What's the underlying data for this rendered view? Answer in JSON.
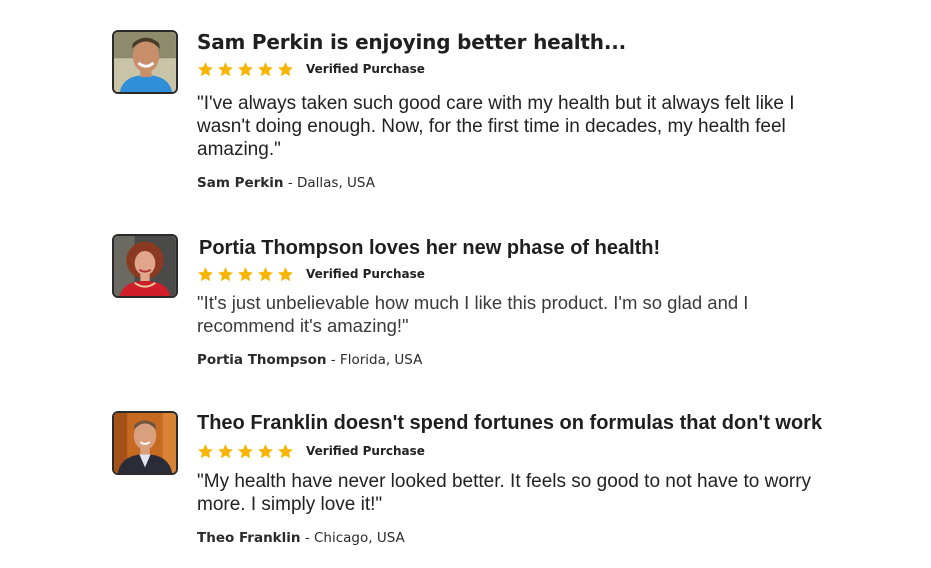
{
  "colors": {
    "star": "#f7b500",
    "text": "#222222",
    "avatar_border": "#2b2b2b"
  },
  "reviews": [
    {
      "title": "Sam Perkin is enjoying better health...",
      "stars": 5,
      "verified_label": "Verified Purchase",
      "quote": "\"I've always taken such good care with my health but it always felt like I wasn't doing enough. Now, for the first time in decades, my health feel amazing.\"",
      "author_name": "Sam Perkin",
      "author_location": " - Dallas, USA",
      "avatar_icon": "avatar-photo-man-smiling"
    },
    {
      "title": "Portia Thompson loves her new phase of health!",
      "stars": 5,
      "verified_label": "Verified Purchase",
      "quote": "\"It's just unbelievable how much I like this product. I'm so glad and I recommend it's amazing!\"",
      "author_name": "Portia Thompson",
      "author_location": " - Florida, USA",
      "avatar_icon": "avatar-photo-woman-red-hair"
    },
    {
      "title": "Theo Franklin doesn't spend fortunes on formulas that don't work",
      "stars": 5,
      "verified_label": "Verified Purchase",
      "quote": "\"My health have never looked better. It feels so good to not have to worry more. I simply love it!\"",
      "author_name": "Theo Franklin",
      "author_location": " - Chicago, USA",
      "avatar_icon": "avatar-photo-man-suit"
    }
  ]
}
